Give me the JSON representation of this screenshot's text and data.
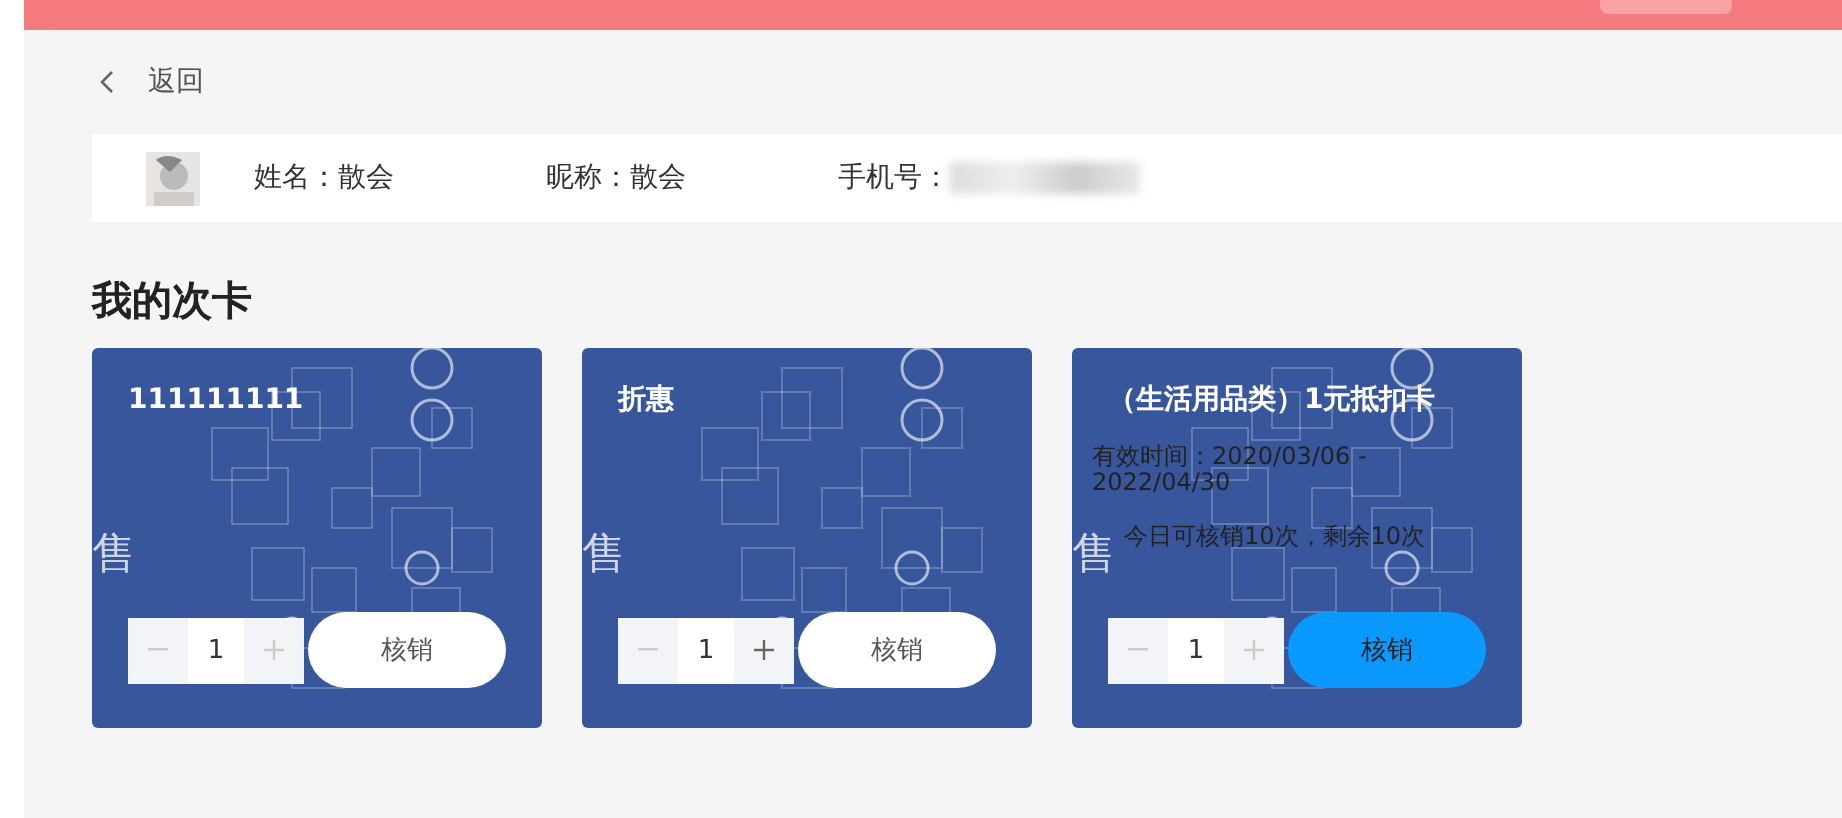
{
  "back": {
    "label": "返回"
  },
  "member": {
    "name": "姓名：散会",
    "nickname": "昵称：散会",
    "phone_label": "手机号："
  },
  "section_title": "我的次卡",
  "cards": [
    {
      "title": "111111111",
      "watermark": "售",
      "quantity": "1",
      "minus_disabled": true,
      "plus_disabled": true,
      "action": "核销",
      "highlighted": false
    },
    {
      "title": "折惠",
      "watermark": "售",
      "quantity": "1",
      "minus_disabled": true,
      "plus_disabled": false,
      "action": "核销",
      "highlighted": false
    },
    {
      "title": "（生活用品类）1元抵扣卡",
      "validity": "有效时间：2020/03/06 - 2022/04/30",
      "usage": "今日可核销10次，剩余10次",
      "watermark": "售",
      "quantity": "1",
      "minus_disabled": true,
      "plus_disabled": true,
      "action": "核销",
      "highlighted": true
    }
  ]
}
